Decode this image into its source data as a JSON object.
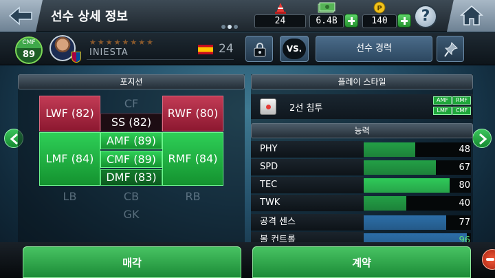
{
  "header": {
    "title": "선수 상세 정보",
    "stats": [
      {
        "icon": "cone-icon",
        "value": "24"
      },
      {
        "icon": "cash-icon",
        "value": "6.4B"
      },
      {
        "icon": "coin-icon",
        "value": "140",
        "icon_letter": "P"
      }
    ],
    "help_label": "?"
  },
  "player": {
    "position": "CMF",
    "overall": "89",
    "name": "INIESTA",
    "stars": [
      "★",
      "★",
      "★",
      "★",
      "★",
      "★",
      "★",
      "★"
    ],
    "star_count": 8,
    "age": "24",
    "nationality_flag": "spain-flag-icon",
    "club_icon": "barcelona-crest-icon"
  },
  "actions": {
    "vs_label": "VS.",
    "career_label": "선수 경력"
  },
  "positions_panel": {
    "title": "포지션",
    "cells": {
      "cf": "CF",
      "lwf": "LWF (82)",
      "ss": "SS (82)",
      "rwf": "RWF (80)",
      "lmf": "LMF (84)",
      "amf": "AMF (89)",
      "cmf": "CMF (89)",
      "rmf": "RMF (84)",
      "dmf": "DMF (83)",
      "lb": "LB",
      "cb": "CB",
      "rb": "RB",
      "gk": "GK"
    }
  },
  "playstyle": {
    "title": "플레이 스타일",
    "name": "2선 침투",
    "positions": [
      "AMF",
      "RMF",
      "LMF",
      "CMF"
    ]
  },
  "abilities": {
    "title": "능력",
    "items": [
      {
        "label": "PHY",
        "value": 48,
        "text": "48",
        "color": "#23a046"
      },
      {
        "label": "SPD",
        "value": 67,
        "text": "67",
        "color": "#23a046"
      },
      {
        "label": "TEC",
        "value": 80,
        "text": "80",
        "color": "#2fca59"
      },
      {
        "label": "TWK",
        "value": 40,
        "text": "40",
        "color": "#23a046"
      },
      {
        "label": "공격 센스",
        "value": 77,
        "text": "77",
        "color": "#2c6ea8"
      },
      {
        "label": "볼 컨트롤",
        "value": 96,
        "text": "96",
        "color": "#2c6ea8"
      }
    ]
  },
  "bottom": {
    "sell_label": "매각",
    "contract_label": "계약"
  }
}
